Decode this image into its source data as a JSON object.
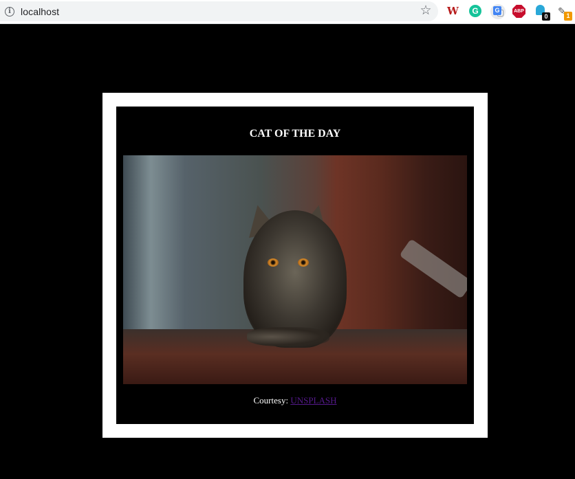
{
  "browser": {
    "url": "localhost",
    "icons": {
      "info": "info-icon",
      "bookmark": "star-icon"
    },
    "extensions": [
      {
        "name": "w-extension-icon",
        "label": "W"
      },
      {
        "name": "grammarly-icon",
        "label": "G"
      },
      {
        "name": "google-translate-icon",
        "label": "G"
      },
      {
        "name": "adblock-plus-icon",
        "label": "ABP"
      },
      {
        "name": "ghostery-icon",
        "badge": "0"
      },
      {
        "name": "extension-icon",
        "badge": "1"
      }
    ]
  },
  "card": {
    "title": "CAT OF THE DAY",
    "image_subject": "tabby kitten on wooden step",
    "courtesy_label": "Courtesy: ",
    "courtesy_link": "UNSPLASH"
  },
  "colors": {
    "page_bg": "#000000",
    "frame": "#ffffff",
    "visited_link": "#551a8b"
  }
}
